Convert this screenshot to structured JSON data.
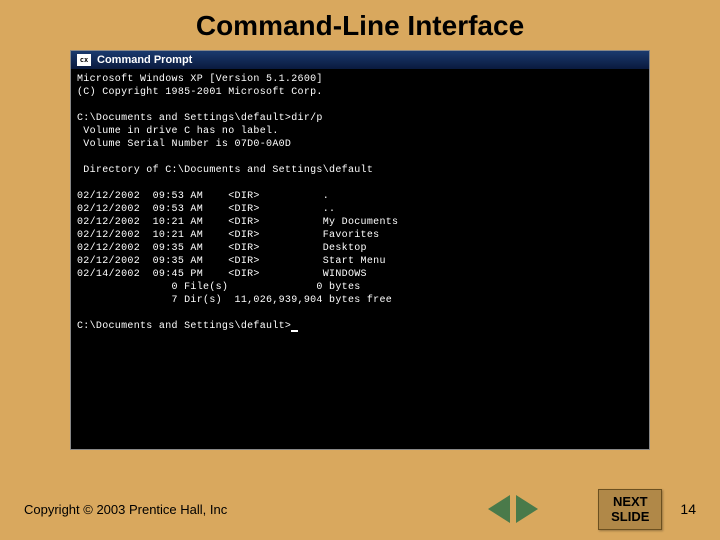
{
  "title": "Command-Line Interface",
  "window": {
    "icon_label": "cx",
    "title": "Command Prompt"
  },
  "terminal": {
    "line1": "Microsoft Windows XP [Version 5.1.2600]",
    "line2": "(C) Copyright 1985-2001 Microsoft Corp.",
    "line3": "",
    "line4": "C:\\Documents and Settings\\default>dir/p",
    "line5": " Volume in drive C has no label.",
    "line6": " Volume Serial Number is 07D0-0A0D",
    "line7": "",
    "line8": " Directory of C:\\Documents and Settings\\default",
    "line9": "",
    "row1": "02/12/2002  09:53 AM    <DIR>          .",
    "row2": "02/12/2002  09:53 AM    <DIR>          ..",
    "row3": "02/12/2002  10:21 AM    <DIR>          My Documents",
    "row4": "02/12/2002  10:21 AM    <DIR>          Favorites",
    "row5": "02/12/2002  09:35 AM    <DIR>          Desktop",
    "row6": "02/12/2002  09:35 AM    <DIR>          Start Menu",
    "row7": "02/14/2002  09:45 PM    <DIR>          WINDOWS",
    "summary1": "               0 File(s)              0 bytes",
    "summary2": "               7 Dir(s)  11,026,939,904 bytes free",
    "line10": "",
    "prompt": "C:\\Documents and Settings\\default>"
  },
  "footer": {
    "copyright": "Copyright © 2003 Prentice Hall, Inc",
    "next_line1": "NEXT",
    "next_line2": "SLIDE",
    "slide_number": "14"
  }
}
